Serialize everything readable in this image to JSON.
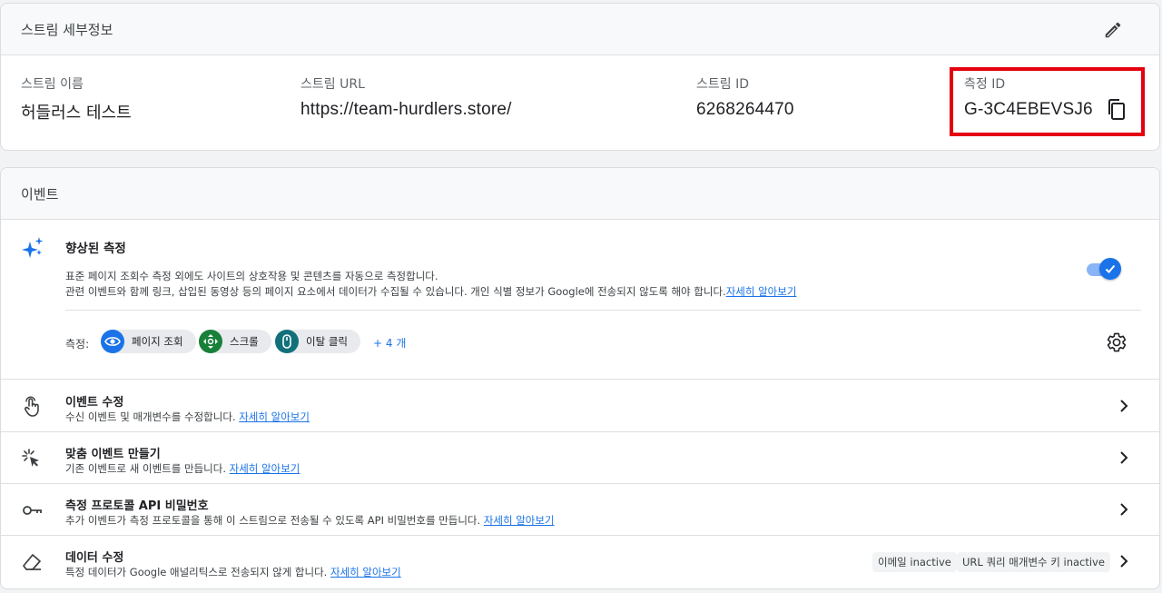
{
  "details": {
    "title": "스트림 세부정보",
    "name_label": "스트림 이름",
    "name_value": "허들러스 테스트",
    "url_label": "스트림 URL",
    "url_value": "https://team-hurdlers.store/",
    "id_label": "스트림 ID",
    "id_value": "6268264470",
    "measure_label": "측정 ID",
    "measure_value": "G-3C4EBEVSJ6"
  },
  "events": {
    "title": "이벤트",
    "enhanced": {
      "title": "향상된 측정",
      "desc_line1": "표준 페이지 조회수 측정 외에도 사이트의 상호작용 및 콘텐츠를 자동으로 측정합니다.",
      "desc_line2": "관련 이벤트와 함께 링크, 삽입된 동영상 등의 페이지 요소에서 데이터가 수집될 수 있습니다. 개인 식별 정보가 Google에 전송되지 않도록 해야 합니다.",
      "learn_more": "자세히 알아보기",
      "toggle_on": true,
      "measure_label": "측정:",
      "chips": [
        {
          "label": "페이지 조회",
          "icon": "eye-icon",
          "color": "#1a73e8"
        },
        {
          "label": "스크롤",
          "icon": "scroll-arrows-icon",
          "color": "#188038"
        },
        {
          "label": "이탈 클릭",
          "icon": "mouse-icon",
          "color": "#12707b"
        }
      ],
      "more": "+ 4 개"
    },
    "rows": [
      {
        "title": "이벤트 수정",
        "desc": "수신 이벤트 및 매개변수를 수정합니다.",
        "link": "자세히 알아보기",
        "icon": "touch-icon"
      },
      {
        "title": "맞춤 이벤트 만들기",
        "desc": "기존 이벤트로 새 이벤트를 만듭니다.",
        "link": "자세히 알아보기",
        "icon": "click-sparkle-icon"
      },
      {
        "title": "측정 프로토콜 API 비밀번호",
        "desc": "추가 이벤트가 측정 프로토콜을 통해 이 스트림으로 전송될 수 있도록 API 비밀번호를 만듭니다.",
        "link": "자세히 알아보기",
        "icon": "key-icon"
      },
      {
        "title": "데이터 수정",
        "desc": "특정 데이터가 Google 애널리틱스로 전송되지 않게 합니다.",
        "link": "자세히 알아보기",
        "icon": "eraser-icon"
      }
    ],
    "badges": [
      "이메일 inactive",
      "URL 쿼리 매개변수 키 inactive"
    ]
  },
  "colors": {
    "accent": "#1a73e8",
    "highlight": "#e4000f"
  }
}
